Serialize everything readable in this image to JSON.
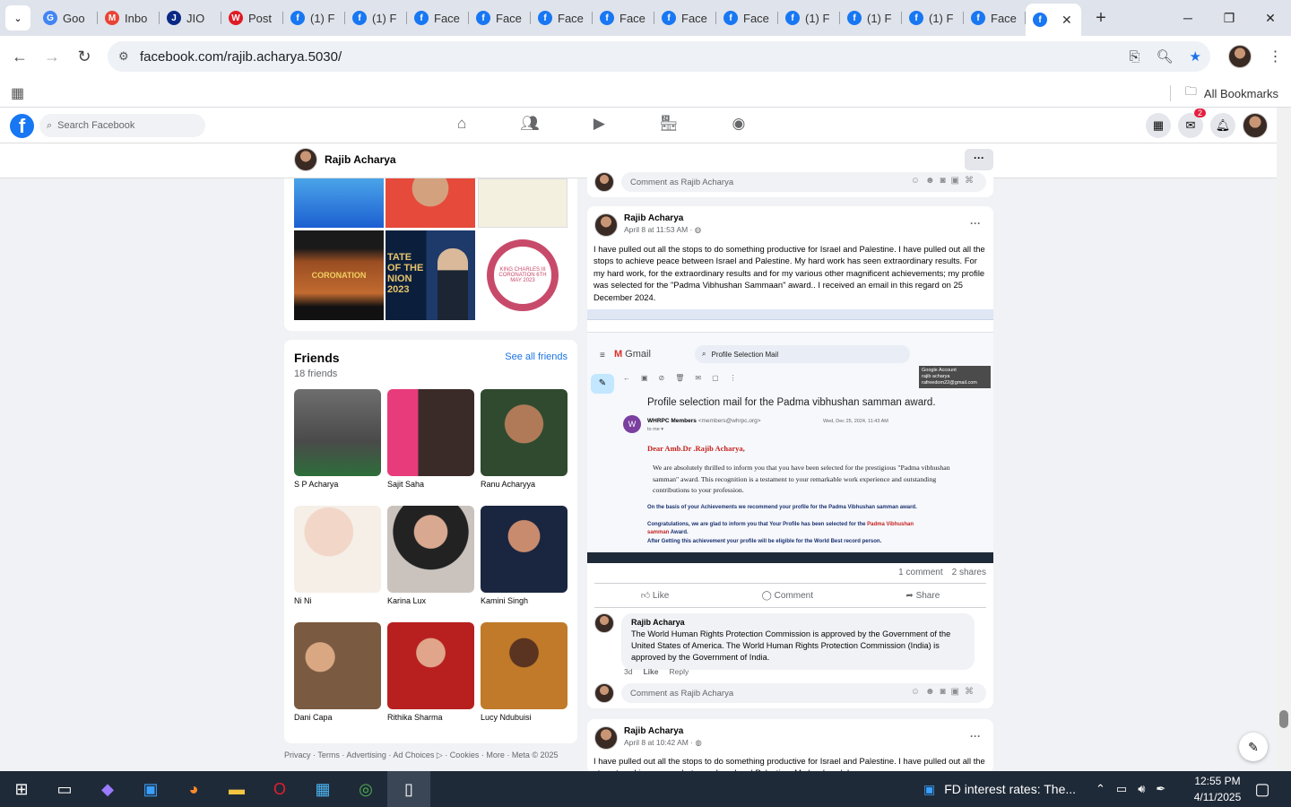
{
  "browser": {
    "tabs": [
      {
        "label": "Goo",
        "icon": "google-icon"
      },
      {
        "label": "Inbo",
        "icon": "gmail-icon"
      },
      {
        "label": "JIO",
        "icon": "jio-icon"
      },
      {
        "label": "Post",
        "icon": "wish-icon"
      },
      {
        "label": "(1) F",
        "icon": "facebook-icon"
      },
      {
        "label": "(1) F",
        "icon": "facebook-icon"
      },
      {
        "label": "Face",
        "icon": "facebook-icon"
      },
      {
        "label": "Face",
        "icon": "facebook-icon"
      },
      {
        "label": "Face",
        "icon": "facebook-icon"
      },
      {
        "label": "Face",
        "icon": "facebook-icon"
      },
      {
        "label": "Face",
        "icon": "facebook-icon"
      },
      {
        "label": "Face",
        "icon": "facebook-icon"
      },
      {
        "label": "(1) F",
        "icon": "facebook-icon"
      },
      {
        "label": "(1) F",
        "icon": "facebook-icon"
      },
      {
        "label": "(1) F",
        "icon": "facebook-icon"
      },
      {
        "label": "Face",
        "icon": "facebook-icon"
      }
    ],
    "url": "facebook.com/rajib.acharya.5030/",
    "all_bookmarks": "All Bookmarks"
  },
  "facebook": {
    "search_placeholder": "Search Facebook",
    "messenger_badge": "2",
    "brand_color": "#1877f2"
  },
  "profile": {
    "name": "Rajib Acharya"
  },
  "photos": {
    "captions": [
      "TATE OF THE NION 2023",
      "CORONATION",
      "KING CHARLES III CORONATION 6TH MAY 2023"
    ]
  },
  "friends": {
    "title": "Friends",
    "count": "18 friends",
    "see_all": "See all friends",
    "list": [
      {
        "name": "S P Acharya"
      },
      {
        "name": "Sajit Saha"
      },
      {
        "name": "Ranu Acharyya"
      },
      {
        "name": "Ni Ni"
      },
      {
        "name": "Karina Lux"
      },
      {
        "name": "Kamini Singh"
      },
      {
        "name": "Dani Capa"
      },
      {
        "name": "Rithika Sharma"
      },
      {
        "name": "Lucy Ndubuisi"
      }
    ]
  },
  "footer": "Privacy · Terms · Advertising · Ad Choices ▷ · Cookies · More · Meta © 2025",
  "comment_placeholder": "Comment as Rajib Acharya",
  "post1": {
    "author": "Rajib Acharya",
    "date": "April 8 at 11:53 AM · ",
    "text": "I have pulled out all the stops to do something productive for Israel and Palestine. I have pulled out all the stops to achieve peace between Israel and Palestine. My hard work has seen extraordinary results. For my hard work, for the extraordinary results and for my various other magnificent achievements; my profile was selected for the \"Padma Vibhushan Sammaan\" award.. I received an email in this regard on 25 December 2024.",
    "comments_count": "1 comment",
    "shares_count": "2 shares",
    "like": "Like",
    "comment": "Comment",
    "share": "Share",
    "email": {
      "app": "Gmail",
      "search": "Profile Selection Mail",
      "account_label": "Google Account",
      "account_name": "rajib acharya",
      "account_email": "rafreedom22@gmail.com",
      "subject": "Profile selection mail for the Padma vibhushan samman award.",
      "sender": "WHRPC Members",
      "sender_email": "<members@whrpc.org>",
      "to": "to me ▾",
      "date": "Wed, Dec 25, 2024, 11:43 AM",
      "greeting": "Dear Amb.Dr .Rajib Acharya,",
      "para1": "We are absolutely thrilled to inform you that you have been selected for the prestigious \"Padma vibhushan samman\" award. This recognition is a testament to your remarkable work experience and outstanding contributions to your profession.",
      "para2": "On the basis of your Achievements we recommend your profile for the Padma Vibhushan samman award.",
      "para3a": "Congratulations, we are glad to inform you that Your Profile has been selected for the ",
      "para3b": "Padma Vibhushan samman",
      "para3c": " Award.",
      "para4": "After Getting this achievement your profile will be eligible for the World Best record person."
    },
    "reply": {
      "author": "Rajib Acharya",
      "text": "The World Human Rights Protection Commission is approved by the Government of the United States of America. The World Human Rights Protection Commission (India) is approved by the Government of India.",
      "age": "3d",
      "like": "Like",
      "reply": "Reply"
    }
  },
  "post2": {
    "author": "Rajib Acharya",
    "date": "April 8 at 10:42 AM · ",
    "text": "I have pulled out all the  stops to do something productive for Israel and Palestine. I have pulled out all the stops to achieve peace between Israel and Palestine. My hard work has seen"
  },
  "taskbar": {
    "news": "FD interest rates: The...",
    "time": "12:55 PM",
    "date": "4/11/2025"
  }
}
